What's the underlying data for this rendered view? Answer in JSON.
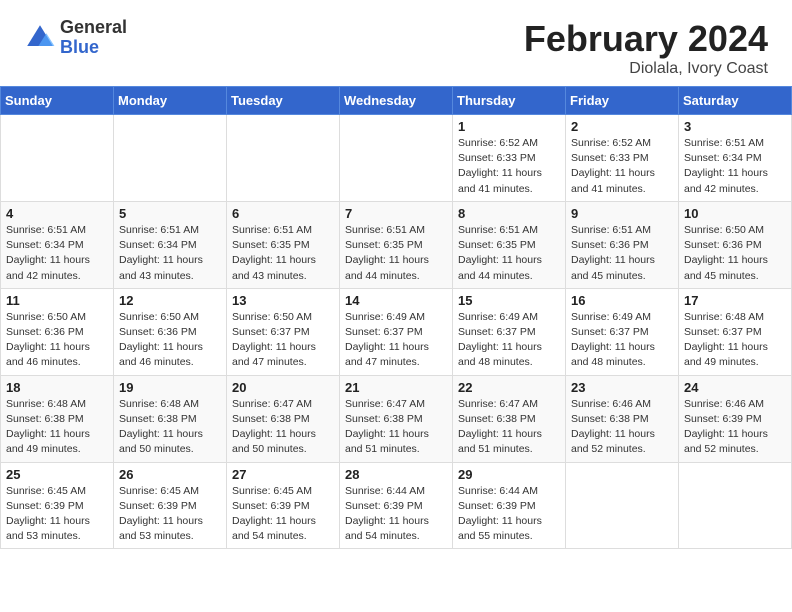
{
  "header": {
    "title": "February 2024",
    "location": "Diolala, Ivory Coast",
    "logo_general": "General",
    "logo_blue": "Blue"
  },
  "days_of_week": [
    "Sunday",
    "Monday",
    "Tuesday",
    "Wednesday",
    "Thursday",
    "Friday",
    "Saturday"
  ],
  "weeks": [
    [
      {
        "day": "",
        "info": ""
      },
      {
        "day": "",
        "info": ""
      },
      {
        "day": "",
        "info": ""
      },
      {
        "day": "",
        "info": ""
      },
      {
        "day": "1",
        "info": "Sunrise: 6:52 AM\nSunset: 6:33 PM\nDaylight: 11 hours\nand 41 minutes."
      },
      {
        "day": "2",
        "info": "Sunrise: 6:52 AM\nSunset: 6:33 PM\nDaylight: 11 hours\nand 41 minutes."
      },
      {
        "day": "3",
        "info": "Sunrise: 6:51 AM\nSunset: 6:34 PM\nDaylight: 11 hours\nand 42 minutes."
      }
    ],
    [
      {
        "day": "4",
        "info": "Sunrise: 6:51 AM\nSunset: 6:34 PM\nDaylight: 11 hours\nand 42 minutes."
      },
      {
        "day": "5",
        "info": "Sunrise: 6:51 AM\nSunset: 6:34 PM\nDaylight: 11 hours\nand 43 minutes."
      },
      {
        "day": "6",
        "info": "Sunrise: 6:51 AM\nSunset: 6:35 PM\nDaylight: 11 hours\nand 43 minutes."
      },
      {
        "day": "7",
        "info": "Sunrise: 6:51 AM\nSunset: 6:35 PM\nDaylight: 11 hours\nand 44 minutes."
      },
      {
        "day": "8",
        "info": "Sunrise: 6:51 AM\nSunset: 6:35 PM\nDaylight: 11 hours\nand 44 minutes."
      },
      {
        "day": "9",
        "info": "Sunrise: 6:51 AM\nSunset: 6:36 PM\nDaylight: 11 hours\nand 45 minutes."
      },
      {
        "day": "10",
        "info": "Sunrise: 6:50 AM\nSunset: 6:36 PM\nDaylight: 11 hours\nand 45 minutes."
      }
    ],
    [
      {
        "day": "11",
        "info": "Sunrise: 6:50 AM\nSunset: 6:36 PM\nDaylight: 11 hours\nand 46 minutes."
      },
      {
        "day": "12",
        "info": "Sunrise: 6:50 AM\nSunset: 6:36 PM\nDaylight: 11 hours\nand 46 minutes."
      },
      {
        "day": "13",
        "info": "Sunrise: 6:50 AM\nSunset: 6:37 PM\nDaylight: 11 hours\nand 47 minutes."
      },
      {
        "day": "14",
        "info": "Sunrise: 6:49 AM\nSunset: 6:37 PM\nDaylight: 11 hours\nand 47 minutes."
      },
      {
        "day": "15",
        "info": "Sunrise: 6:49 AM\nSunset: 6:37 PM\nDaylight: 11 hours\nand 48 minutes."
      },
      {
        "day": "16",
        "info": "Sunrise: 6:49 AM\nSunset: 6:37 PM\nDaylight: 11 hours\nand 48 minutes."
      },
      {
        "day": "17",
        "info": "Sunrise: 6:48 AM\nSunset: 6:37 PM\nDaylight: 11 hours\nand 49 minutes."
      }
    ],
    [
      {
        "day": "18",
        "info": "Sunrise: 6:48 AM\nSunset: 6:38 PM\nDaylight: 11 hours\nand 49 minutes."
      },
      {
        "day": "19",
        "info": "Sunrise: 6:48 AM\nSunset: 6:38 PM\nDaylight: 11 hours\nand 50 minutes."
      },
      {
        "day": "20",
        "info": "Sunrise: 6:47 AM\nSunset: 6:38 PM\nDaylight: 11 hours\nand 50 minutes."
      },
      {
        "day": "21",
        "info": "Sunrise: 6:47 AM\nSunset: 6:38 PM\nDaylight: 11 hours\nand 51 minutes."
      },
      {
        "day": "22",
        "info": "Sunrise: 6:47 AM\nSunset: 6:38 PM\nDaylight: 11 hours\nand 51 minutes."
      },
      {
        "day": "23",
        "info": "Sunrise: 6:46 AM\nSunset: 6:38 PM\nDaylight: 11 hours\nand 52 minutes."
      },
      {
        "day": "24",
        "info": "Sunrise: 6:46 AM\nSunset: 6:39 PM\nDaylight: 11 hours\nand 52 minutes."
      }
    ],
    [
      {
        "day": "25",
        "info": "Sunrise: 6:45 AM\nSunset: 6:39 PM\nDaylight: 11 hours\nand 53 minutes."
      },
      {
        "day": "26",
        "info": "Sunrise: 6:45 AM\nSunset: 6:39 PM\nDaylight: 11 hours\nand 53 minutes."
      },
      {
        "day": "27",
        "info": "Sunrise: 6:45 AM\nSunset: 6:39 PM\nDaylight: 11 hours\nand 54 minutes."
      },
      {
        "day": "28",
        "info": "Sunrise: 6:44 AM\nSunset: 6:39 PM\nDaylight: 11 hours\nand 54 minutes."
      },
      {
        "day": "29",
        "info": "Sunrise: 6:44 AM\nSunset: 6:39 PM\nDaylight: 11 hours\nand 55 minutes."
      },
      {
        "day": "",
        "info": ""
      },
      {
        "day": "",
        "info": ""
      }
    ]
  ]
}
